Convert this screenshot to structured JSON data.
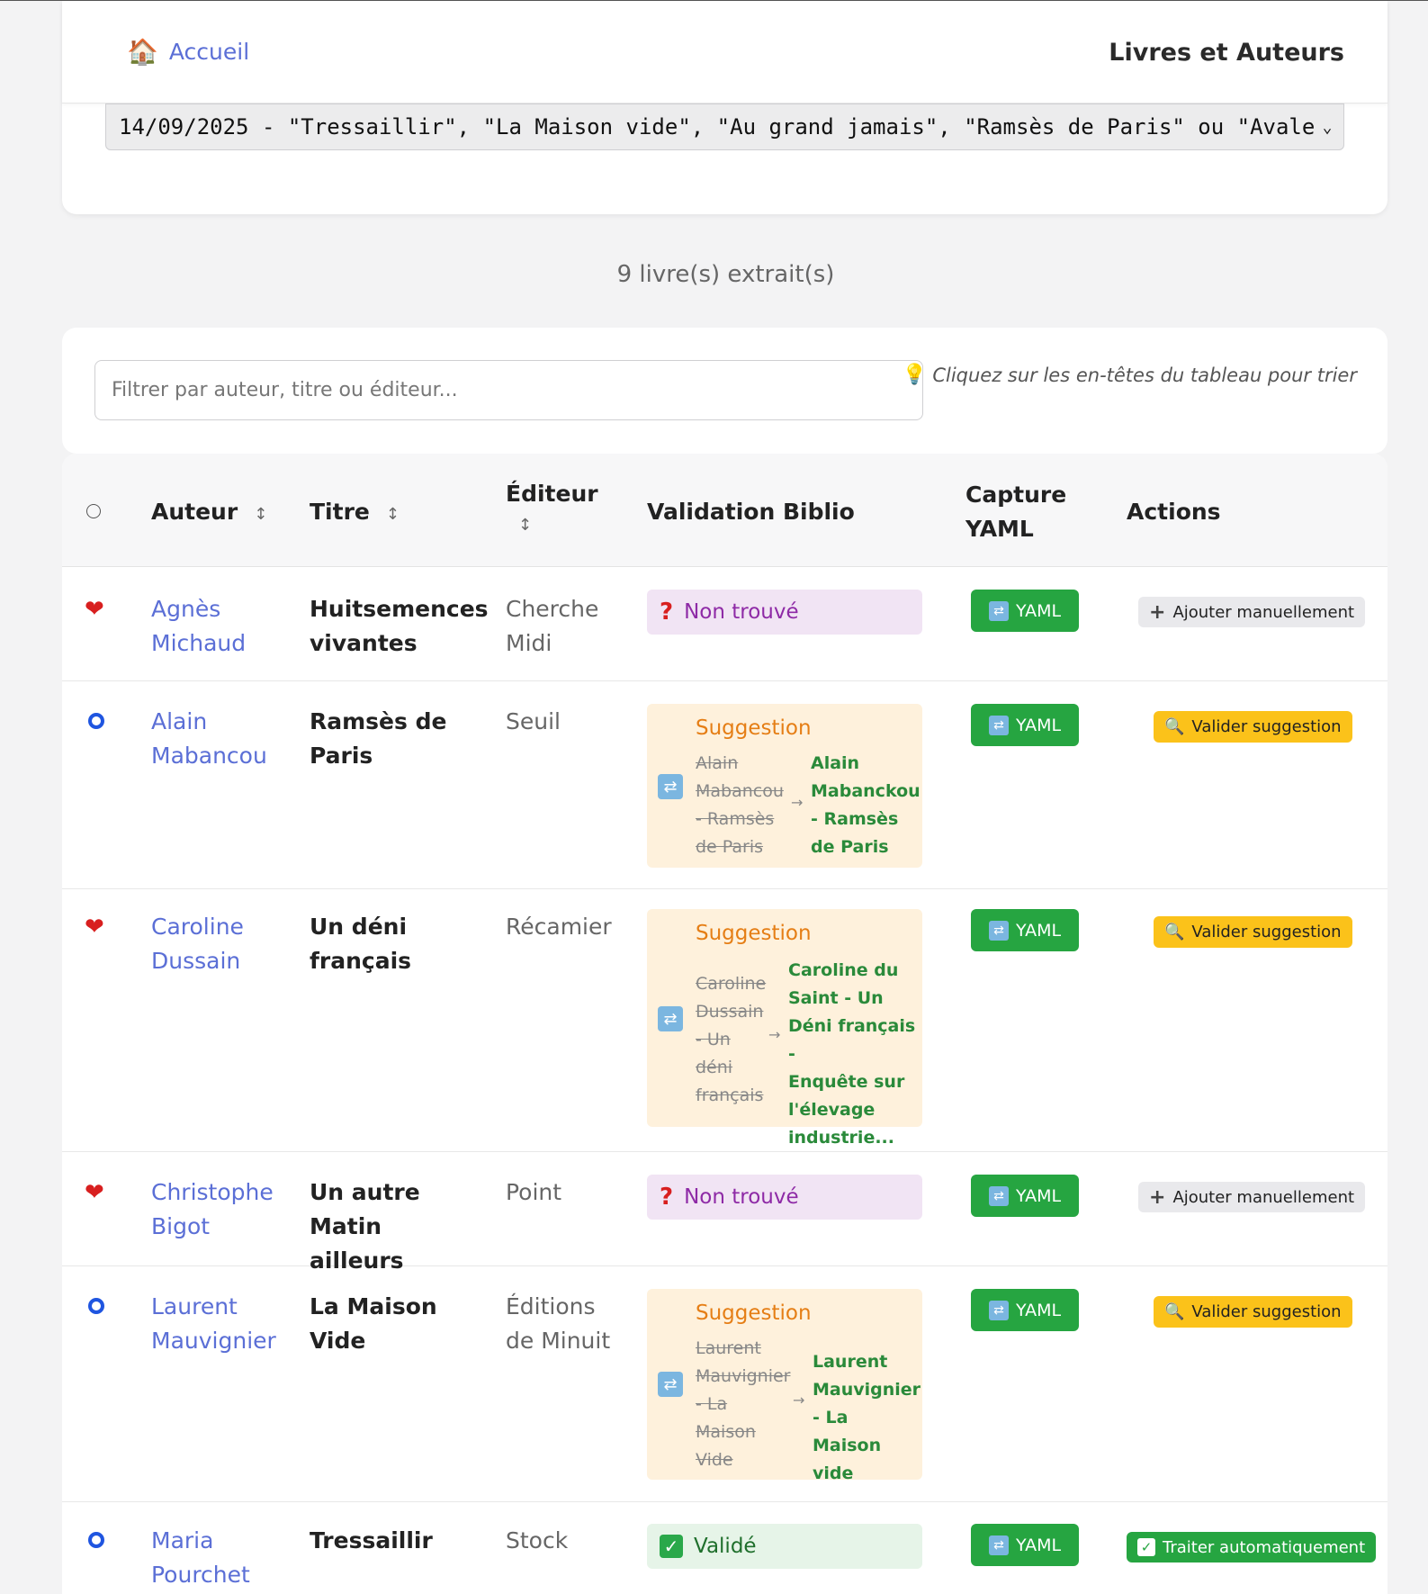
{
  "nav": {
    "home_label": "Accueil",
    "site_title": "Livres et Auteurs"
  },
  "select": {
    "value": "14/09/2025 - \"Tressaillir\", \"La Maison vide\", \"Au grand jamais\", \"Ramsès de Paris\" ou \"Avale\""
  },
  "summary": {
    "count_text": "9 livre(s) extrait(s)"
  },
  "filter": {
    "placeholder": "Filtrer par auteur, titre ou éditeur...",
    "hint": "Cliquez sur les en-têtes du tableau pour trier"
  },
  "table": {
    "headers": {
      "author": "Auteur",
      "title": "Titre",
      "publisher": "Éditeur",
      "validation": "Validation Biblio",
      "capture_line1": "Capture",
      "capture_line2": "YAML",
      "actions": "Actions",
      "sort_glyph": "↕"
    },
    "rows": [
      {
        "favorite": true,
        "author_first": "Agnès",
        "author_last": "Michaud",
        "title_line1": "Huitsemences",
        "title_line2": "vivantes",
        "publisher_line1": "Cherche",
        "publisher_line2": "Midi",
        "status": "Non trouvé",
        "yaml_label": "YAML",
        "action_label": "Ajouter manuellement"
      },
      {
        "favorite": false,
        "author_first": "Alain",
        "author_last": "Mabancou",
        "title_line1": "Ramsès de",
        "title_line2": "Paris",
        "publisher_line1": "Seuil",
        "suggestion_label": "Suggestion",
        "old_lines": [
          "Alain",
          "Mabancou",
          "- Ramsès",
          "de Paris"
        ],
        "new_lines": [
          "Alain",
          "Mabanckou",
          "- Ramsès",
          "de Paris"
        ],
        "yaml_label": "YAML",
        "action_label": "Valider suggestion"
      },
      {
        "favorite": true,
        "author_first": "Caroline",
        "author_last": "Dussain",
        "title_line1": "Un déni",
        "title_line2": "français",
        "publisher_line1": "Récamier",
        "suggestion_label": "Suggestion",
        "old_lines": [
          "Caroline",
          "Dussain",
          "- Un",
          "déni",
          "français"
        ],
        "new_lines": [
          "Caroline du",
          "Saint - Un",
          "Déni français -",
          "Enquête sur",
          "l'élevage",
          "industrie..."
        ],
        "yaml_label": "YAML",
        "action_label": "Valider suggestion"
      },
      {
        "favorite": true,
        "author_first": "Christophe",
        "author_last": "Bigot",
        "title_line1": "Un autre",
        "title_line2": "Matin ailleurs",
        "publisher_line1": "Point",
        "status": "Non trouvé",
        "yaml_label": "YAML",
        "action_label": "Ajouter manuellement"
      },
      {
        "favorite": false,
        "author_first": "Laurent",
        "author_last": "Mauvignier",
        "title_line1": "La Maison",
        "title_line2": "Vide",
        "publisher_line1": "Éditions",
        "publisher_line2": "de Minuit",
        "suggestion_label": "Suggestion",
        "old_lines": [
          "Laurent",
          "Mauvignier",
          "- La",
          "Maison",
          "Vide"
        ],
        "new_lines": [
          "Laurent",
          "Mauvignier",
          "- La Maison",
          "vide"
        ],
        "yaml_label": "YAML",
        "action_label": "Valider suggestion"
      },
      {
        "favorite": false,
        "author_first": "Maria",
        "author_last": "Pourchet",
        "title_line1": "Tressaillir",
        "publisher_line1": "Stock",
        "status": "Validé",
        "yaml_label": "YAML",
        "action_label": "Traiter automatiquement"
      }
    ]
  },
  "icons": {
    "home": "house-icon",
    "bulb": "lightbulb-icon",
    "favorite": "heart-icon",
    "unfavorite": "ring-icon",
    "not_found": "question-icon",
    "validated": "check-icon",
    "sync": "sync-icon",
    "add": "plus-icon",
    "validate": "magnifier-icon"
  },
  "colors": {
    "link": "#5b6fd6",
    "heart": "#d81f1f",
    "ring": "#1f55e0",
    "yaml_button": "#26a541",
    "validate_button": "#fbc21a",
    "suggestion_bg": "#fef1dc",
    "not_found_bg": "#f1e4f4",
    "valid_bg": "#e6f4e8"
  }
}
